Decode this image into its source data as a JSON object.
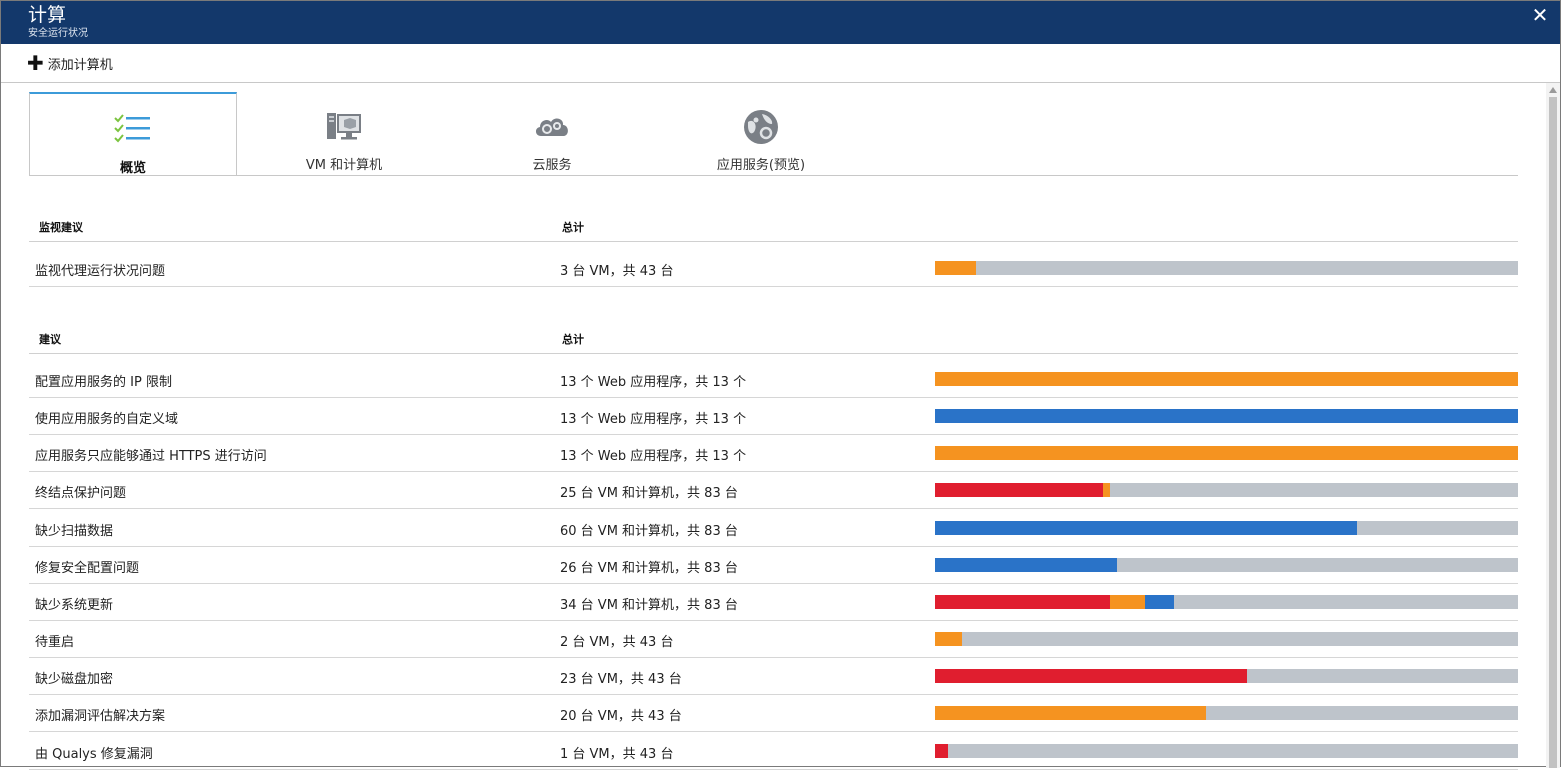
{
  "header": {
    "title": "计算",
    "subtitle": "安全运行状况",
    "close_icon": "close-icon"
  },
  "toolbar": {
    "add_label": "添加计算机",
    "add_icon": "plus-icon"
  },
  "tabs": [
    {
      "label": "概览",
      "icon": "checklist-icon",
      "active": true
    },
    {
      "label": "VM 和计算机",
      "icon": "vm-computer-icon",
      "active": false
    },
    {
      "label": "云服务",
      "icon": "cloud-gear-icon",
      "active": false
    },
    {
      "label": "应用服务(预览)",
      "icon": "globe-gear-icon",
      "active": false
    }
  ],
  "colors": {
    "red": "#e01e2f",
    "orange": "#f59320",
    "blue": "#2a73c8",
    "gray": "#bec4cb",
    "header_bg": "#13386b",
    "tab_accent": "#3c9bd9"
  },
  "monitoring": {
    "col_name": "监视建议",
    "col_total": "总计",
    "rows": [
      {
        "name": "监视代理运行状况问题",
        "total": "3 台 VM，共 43 台",
        "segments": [
          {
            "color": "orange",
            "fraction": 0.07
          }
        ]
      }
    ]
  },
  "recommendations": {
    "col_name": "建议",
    "col_total": "总计",
    "rows": [
      {
        "name": "配置应用服务的 IP 限制",
        "total": "13 个 Web 应用程序，共 13 个",
        "segments": [
          {
            "color": "orange",
            "fraction": 1.0
          }
        ]
      },
      {
        "name": "使用应用服务的自定义域",
        "total": "13 个 Web 应用程序，共 13 个",
        "segments": [
          {
            "color": "blue",
            "fraction": 1.0
          }
        ]
      },
      {
        "name": "应用服务只应能够通过 HTTPS 进行访问",
        "total": "13 个 Web 应用程序，共 13 个",
        "segments": [
          {
            "color": "orange",
            "fraction": 1.0
          }
        ]
      },
      {
        "name": "终结点保护问题",
        "total": "25 台 VM 和计算机，共 83 台",
        "segments": [
          {
            "color": "red",
            "fraction": 0.289
          },
          {
            "color": "orange",
            "fraction": 0.012
          }
        ]
      },
      {
        "name": "缺少扫描数据",
        "total": "60 台 VM 和计算机，共 83 台",
        "segments": [
          {
            "color": "blue",
            "fraction": 0.723
          }
        ]
      },
      {
        "name": "修复安全配置问题",
        "total": "26 台 VM 和计算机，共 83 台",
        "segments": [
          {
            "color": "blue",
            "fraction": 0.313
          }
        ]
      },
      {
        "name": "缺少系统更新",
        "total": "34 台 VM 和计算机，共 83 台",
        "segments": [
          {
            "color": "red",
            "fraction": 0.301
          },
          {
            "color": "orange",
            "fraction": 0.06
          },
          {
            "color": "blue",
            "fraction": 0.049
          }
        ]
      },
      {
        "name": "待重启",
        "total": "2 台 VM，共 43 台",
        "segments": [
          {
            "color": "orange",
            "fraction": 0.046
          }
        ]
      },
      {
        "name": "缺少磁盘加密",
        "total": "23 台 VM，共 43 台",
        "segments": [
          {
            "color": "red",
            "fraction": 0.535
          }
        ]
      },
      {
        "name": "添加漏洞评估解决方案",
        "total": "20 台 VM，共 43 台",
        "segments": [
          {
            "color": "orange",
            "fraction": 0.465
          }
        ]
      },
      {
        "name": "由 Qualys 修复漏洞",
        "total": "1 台 VM，共 43 台",
        "segments": [
          {
            "color": "red",
            "fraction": 0.023
          }
        ]
      }
    ]
  }
}
